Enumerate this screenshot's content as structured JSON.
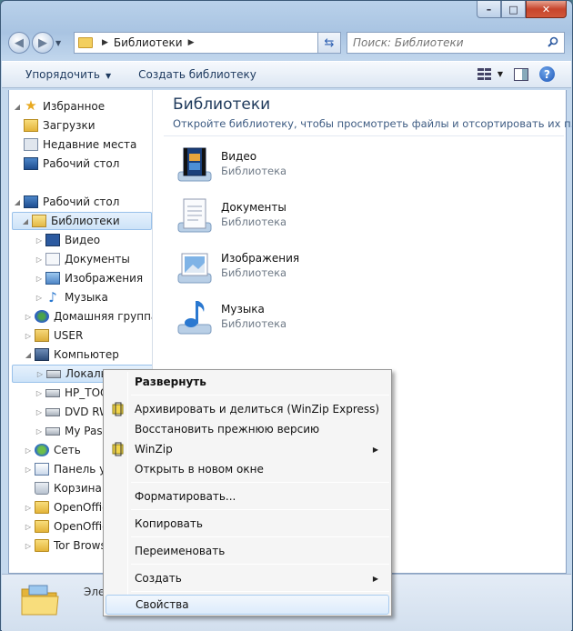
{
  "address": {
    "path": "Библиотеки"
  },
  "search": {
    "placeholder": "Поиск: Библиотеки"
  },
  "toolbar": {
    "organize": "Упорядочить",
    "create_library": "Создать библиотеку"
  },
  "nav": {
    "favorites": "Избранное",
    "downloads": "Загрузки",
    "recent": "Недавние места",
    "desktop_fav": "Рабочий стол",
    "desktop": "Рабочий стол",
    "libraries": "Библиотеки",
    "video": "Видео",
    "documents": "Документы",
    "images": "Изображения",
    "music": "Музыка",
    "homegroup": "Домашняя группа",
    "user": "USER",
    "computer": "Компьютер",
    "local": "Локаль",
    "hp": "HP_TOO",
    "dvd": "DVD RW",
    "mypass": "My Pass",
    "network": "Сеть",
    "panel": "Панель у",
    "trash": "Корзина",
    "oo1": "OpenOffic",
    "oo2": "OpenOffic",
    "tor": "Tor Brows"
  },
  "content": {
    "title": "Библиотеки",
    "subtitle": "Откройте библиотеку, чтобы просмотреть файлы и отсортировать их п...",
    "items": [
      {
        "name": "Видео",
        "type": "Библиотека"
      },
      {
        "name": "Документы",
        "type": "Библиотека"
      },
      {
        "name": "Изображения",
        "type": "Библиотека"
      },
      {
        "name": "Музыка",
        "type": "Библиотека"
      }
    ]
  },
  "status": {
    "label": "Эле"
  },
  "context_menu": {
    "expand": "Развернуть",
    "archive": "Архивировать и делиться (WinZip Express)",
    "restore": "Восстановить прежнюю версию",
    "winzip": "WinZip",
    "open_new": "Открыть в новом окне",
    "format": "Форматировать...",
    "copy": "Копировать",
    "rename": "Переименовать",
    "create": "Создать",
    "properties": "Свойства"
  }
}
